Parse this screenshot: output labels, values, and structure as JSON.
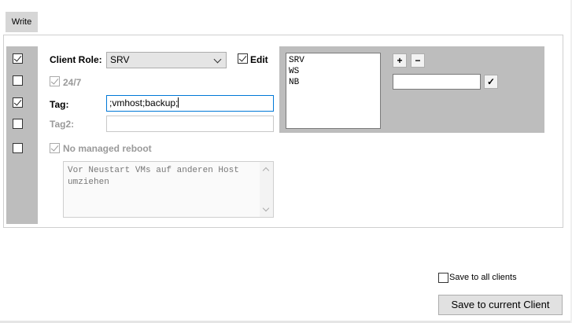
{
  "tab": {
    "write_label": "Write"
  },
  "form": {
    "client_role_label": "Client Role:",
    "client_role_value": "SRV",
    "edit_label": "Edit",
    "always_label": "24/7",
    "tag_label": "Tag:",
    "tag_value": ";vmhost;backup;",
    "tag2_label": "Tag2:",
    "tag2_value": "",
    "reboot_label": "No managed reboot",
    "note_text": "Vor Neustart VMs auf anderen Host umziehen"
  },
  "roles": {
    "items": [
      "SRV",
      "WS",
      "NB"
    ],
    "add_label": "+",
    "remove_label": "−",
    "new_role_value": "",
    "confirm_label": "✓"
  },
  "footer": {
    "save_all_label": "Save to all clients",
    "save_current_label": "Save to current Client"
  }
}
